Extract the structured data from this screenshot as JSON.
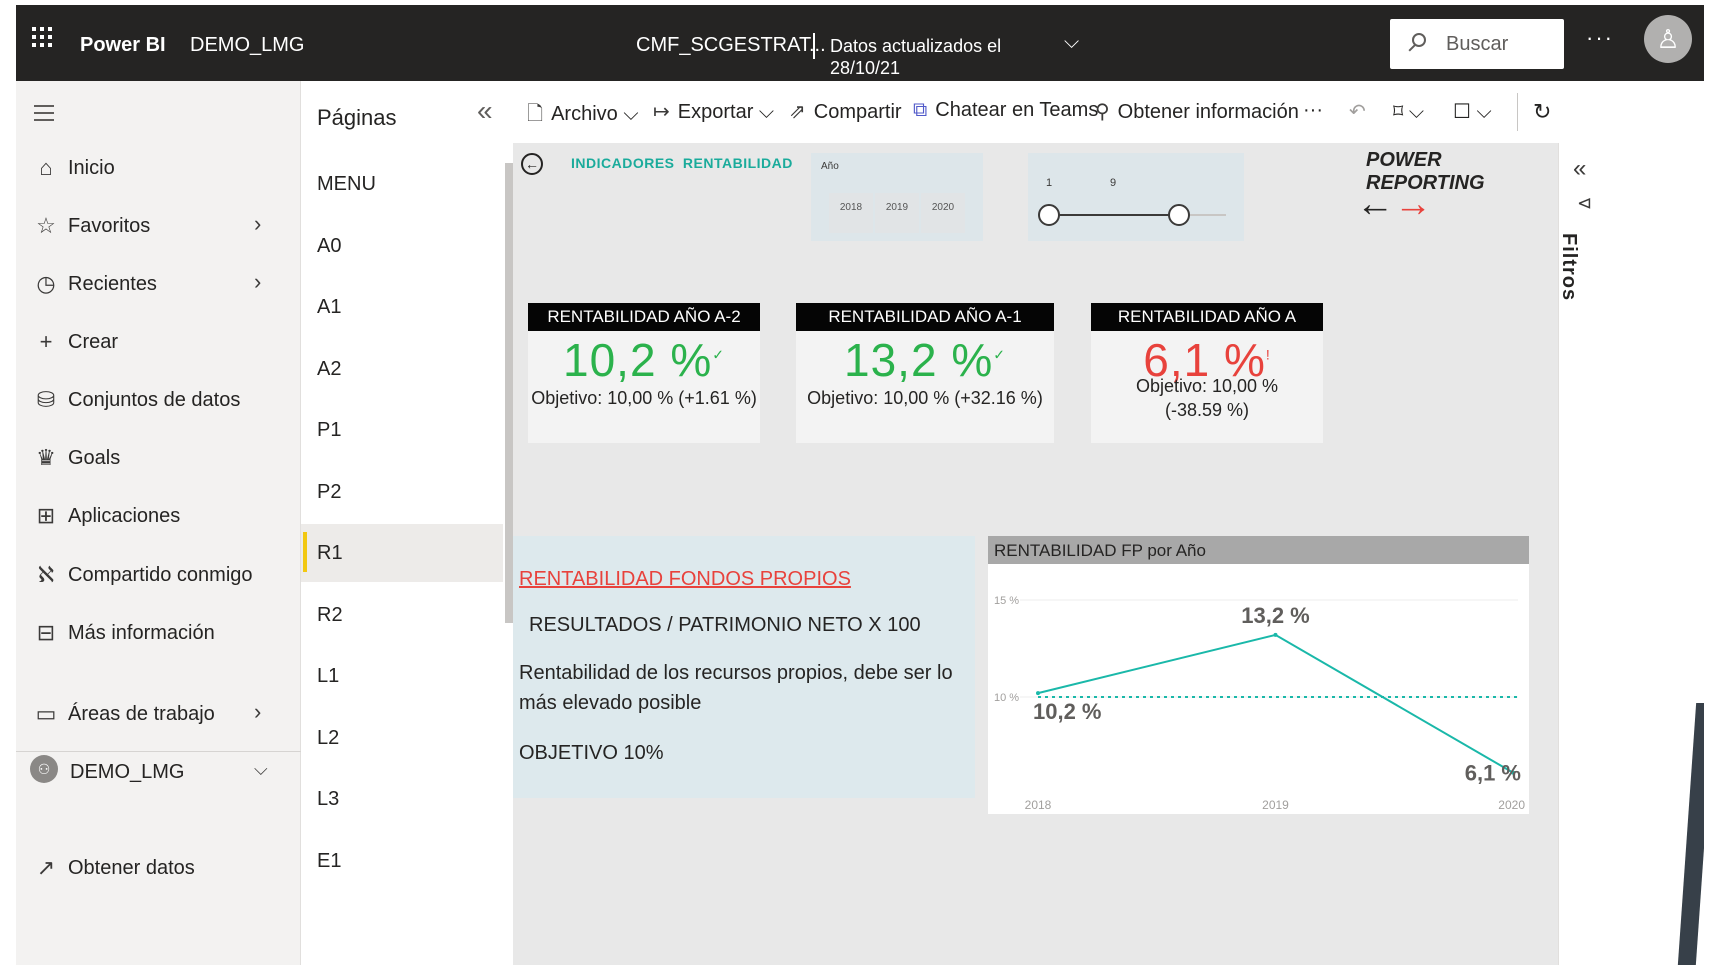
{
  "topbar": {
    "brand": "Power BI",
    "workspace": "DEMO_LMG",
    "report_name": "CMF_SCGESTRAT...",
    "updated_line1": "Datos actualizados el",
    "updated_line2": "28/10/21",
    "search_placeholder": "Buscar",
    "more": "···",
    "chevron": "⌵"
  },
  "leftnav": {
    "items": [
      {
        "label": "Inicio",
        "icon": "home-icon"
      },
      {
        "label": "Favoritos",
        "icon": "star-icon"
      },
      {
        "label": "Recientes",
        "icon": "clock-icon"
      },
      {
        "label": "Crear",
        "icon": "plus-icon"
      },
      {
        "label": "Conjuntos de datos",
        "icon": "database-icon"
      },
      {
        "label": "Goals",
        "icon": "trophy-icon"
      },
      {
        "label": "Aplicaciones",
        "icon": "apps-icon"
      },
      {
        "label": "Compartido conmigo",
        "icon": "shared-icon"
      },
      {
        "label": "Más información",
        "icon": "book-icon"
      },
      {
        "label": "Áreas de trabajo",
        "icon": "workspaces-icon"
      },
      {
        "label": "DEMO_LMG",
        "icon": "workspace-avatar-icon"
      },
      {
        "label": "Obtener datos",
        "icon": "arrow-icon"
      }
    ]
  },
  "pages": {
    "title": "Páginas",
    "items": [
      "MENU",
      "A0",
      "A1",
      "A2",
      "P1",
      "P2",
      "R1",
      "R2",
      "L1",
      "L2",
      "L3",
      "E1"
    ],
    "selected": "R1"
  },
  "toolbar": {
    "archivo": "Archivo",
    "exportar": "Exportar",
    "compartir": "Compartir",
    "teams": "Chatear en Teams",
    "info": "Obtener información",
    "more": "···"
  },
  "report": {
    "header": "INDICADORES RENTABILIDAD",
    "slicer_label": "Año",
    "years": [
      "2018",
      "2019",
      "2020"
    ],
    "range_min": "1",
    "range_max": "9",
    "power_reporting": "POWER REPORTING",
    "kpis": [
      {
        "title": "RENTABILIDAD AÑO A-2",
        "value": "10,2 %",
        "mark": "✓",
        "objective": "Objetivo: 10,00 % (+1.61 %)",
        "objective2": "",
        "color": "#2bb24c"
      },
      {
        "title": "RENTABILIDAD AÑO A-1",
        "value": "13,2 %",
        "mark": "✓",
        "objective": "Objetivo: 10,00 % (+32.16 %)",
        "objective2": "",
        "color": "#2bb24c"
      },
      {
        "title": "RENTABILIDAD AÑO A",
        "value": "6,1 %",
        "mark": "!",
        "objective": "Objetivo: 10,00 %",
        "objective2": "(-38.59 %)",
        "color": "#e8423c"
      }
    ],
    "textbox": {
      "heading": "RENTABILIDAD FONDOS PROPIOS",
      "formula": "RESULTADOS / PATRIMONIO NETO X 100",
      "description": "Rentabilidad de los recursos propios, debe ser lo más elevado posible",
      "objective": "OBJETIVO 10%"
    }
  },
  "filters": {
    "label": "Filtros"
  },
  "colors": {
    "accent_teal": "#1aab9b",
    "line": "#1ab8a9",
    "good": "#2bb24c",
    "bad": "#e8423c"
  },
  "chart_data": {
    "type": "line",
    "title": "RENTABILIDAD FP por Año",
    "categories": [
      "2018",
      "2019",
      "2020"
    ],
    "series": [
      {
        "values": [
          10.2,
          13.2,
          6.1
        ]
      }
    ],
    "data_labels": [
      "10,2 %",
      "13,2 %",
      "6,1 %"
    ],
    "target": 10,
    "yticks": [
      "15 %",
      "10 %"
    ],
    "ylim": [
      5,
      15
    ],
    "grid": true
  }
}
